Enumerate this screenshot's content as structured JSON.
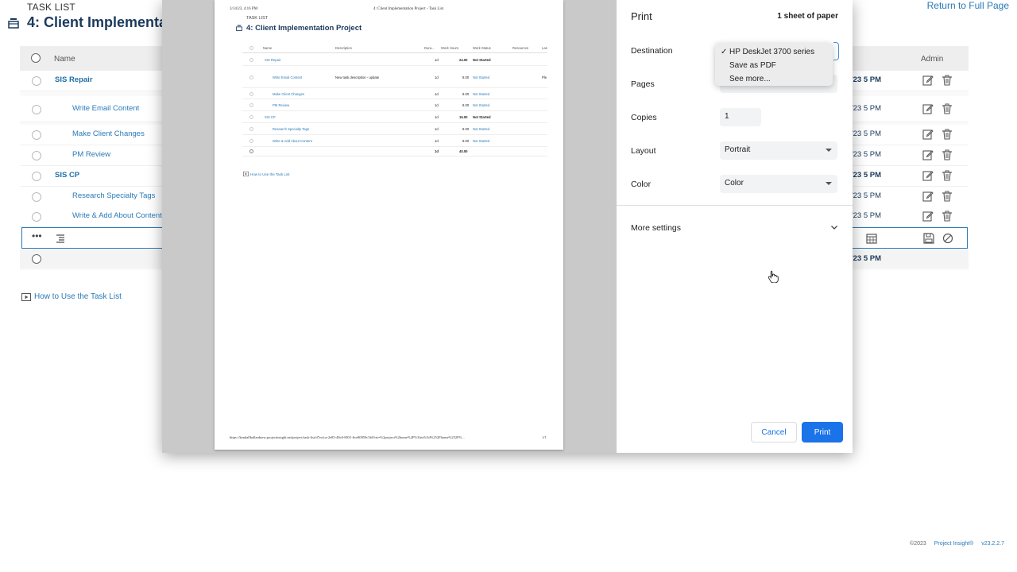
{
  "background": {
    "header_label": "TASK LIST",
    "title": "4: Client Implementati",
    "return_link": "Return to Full Page",
    "columns": {
      "name": "Name",
      "admin": "Admin"
    },
    "rows": [
      {
        "name": "SIS Repair",
        "parent": true,
        "date": "/23 5 PM"
      },
      {
        "name": "Write Email Content",
        "parent": false,
        "date": "/23 5 PM"
      },
      {
        "name": "Make Client Changes",
        "parent": false,
        "date": "/23 5 PM"
      },
      {
        "name": "PM Review",
        "parent": false,
        "date": "/23 5 PM"
      },
      {
        "name": "SIS CP",
        "parent": true,
        "date": "/23 5 PM"
      },
      {
        "name": "Research Specialty Tags",
        "parent": false,
        "date": "/23 5 PM"
      },
      {
        "name": "Write & Add About Content",
        "parent": false,
        "date": "/23 5 PM"
      }
    ],
    "edit_row_more": "•••",
    "total_date": "/23 5 PM",
    "how_to_link": "How to Use the Task List",
    "footer": {
      "copyright": "©2023",
      "brand": "Project Insight®",
      "version": "v23.2.2.7"
    }
  },
  "preview": {
    "date": "3/14/23, 4:16 PM",
    "header_title": "4: Client Implementation Project - Task List",
    "label": "TASK LIST",
    "title": "4: Client Implementation Project",
    "columns": [
      "Name",
      "Description",
      "Dura...",
      "Work Hours",
      "Work Status",
      "Resources",
      "Las"
    ],
    "rows": [
      {
        "name": "SIS Repair",
        "parent": true,
        "desc": "",
        "dur": "1d",
        "hours": "24.00",
        "status": "Not Started",
        "res": ""
      },
      {
        "name": "Write Email Content",
        "parent": false,
        "desc": "New task description - update",
        "dur": "1d",
        "hours": "8.00",
        "status": "Not Started",
        "res": "Ple"
      },
      {
        "name": "Make Client Changes",
        "parent": false,
        "desc": "",
        "dur": "1d",
        "hours": "8.00",
        "status": "Not Started",
        "res": ""
      },
      {
        "name": "PM Review",
        "parent": false,
        "desc": "",
        "dur": "1d",
        "hours": "8.00",
        "status": "Not Started",
        "res": ""
      },
      {
        "name": "SIS CP",
        "parent": true,
        "desc": "",
        "dur": "1d",
        "hours": "16.00",
        "status": "Not Started",
        "res": ""
      },
      {
        "name": "Research Specialty Tags",
        "parent": false,
        "desc": "",
        "dur": "1d",
        "hours": "8.00",
        "status": "Not Started",
        "res": ""
      },
      {
        "name": "Write & Add About Content",
        "parent": false,
        "desc": "",
        "dur": "1d",
        "hours": "8.00",
        "status": "Not Started",
        "res": ""
      }
    ],
    "total": {
      "dur": "1d",
      "hours": "40.00"
    },
    "how_to_link": "How to Use the Task List",
    "url": "https://kendallballardnew.projectinsight.net/project/task-list/d7ecfca-2e85-48c0-8031-6ce80059c5fd?rts=%2project%2home%2F%3frts%3d%252Fhome%252F%...",
    "page_num": "1/1"
  },
  "print": {
    "title": "Print",
    "sheets": "1 sheet of paper",
    "destination_label": "Destination",
    "pages_label": "Pages",
    "copies_label": "Copies",
    "copies_value": "1",
    "layout_label": "Layout",
    "layout_value": "Portrait",
    "color_label": "Color",
    "color_value": "Color",
    "more_settings": "More settings",
    "cancel": "Cancel",
    "print": "Print",
    "destination_options": [
      {
        "label": "HP DeskJet 3700 series",
        "selected": true
      },
      {
        "label": "Save as PDF",
        "selected": false
      },
      {
        "label": "See more...",
        "selected": false
      }
    ]
  },
  "colors": {
    "accent": "#1a73e8",
    "link": "#2a7ab8",
    "title": "#1b3a5c"
  }
}
